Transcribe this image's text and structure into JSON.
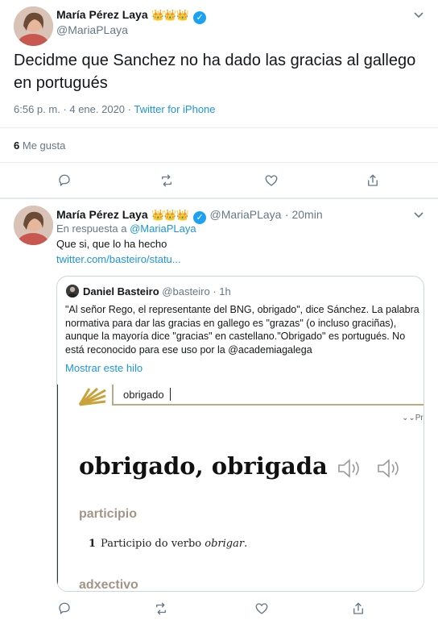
{
  "main_tweet": {
    "name": "María Pérez Laya",
    "crowns": "👑👑👑",
    "handle": "@MariaPLaya",
    "text": "Decidme que Sanchez no ha dado las gracias al gallego en portugués",
    "timestamp": "6:56 p. m. · 4 ene. 2020 · ",
    "source": "Twitter for iPhone",
    "likes_count": "6",
    "likes_label": "Me gusta"
  },
  "reply_tweet": {
    "name": "María Pérez Laya",
    "crowns": "👑👑👑",
    "handle": "@MariaPLaya",
    "time": "· 20min",
    "in_reply_prefix": "En respuesta a ",
    "in_reply_handle": "@MariaPLaya",
    "text": "Que si, que lo ha hecho",
    "link": "twitter.com/basteiro/statu..."
  },
  "quoted_tweet": {
    "name": "Daniel Basteiro",
    "handle": "@basteiro",
    "time": "· 1h",
    "text_before": "\"Al señor Rego, el representante del BNG, obrigado\", dice Sánchez. La palabra normativa para dar las gracias en gallego es \"grazas\" (o incluso graciñas), aunque la mayoría dice \"gracias\" en castellano.\"Obrigado\" es portugués. No está reconocido para ese uso por la ",
    "mention": "@academiagalega",
    "show_thread": "Mostrar este hilo"
  },
  "dictionary": {
    "search_value": "obrigado",
    "corner_text": "Pr",
    "headword": "obrigado, obrigada",
    "section1": "participio",
    "def_number": "1",
    "def_text": "Participio do verbo ",
    "def_italic": "obrigar",
    "def_end": ".",
    "section2": "adxectivo"
  },
  "colors": {
    "accent": "#1da1f2",
    "link": "#1b95e0",
    "muted": "#657786",
    "dict_brown": "#a39586",
    "dict_gold": "#c9a23a"
  }
}
